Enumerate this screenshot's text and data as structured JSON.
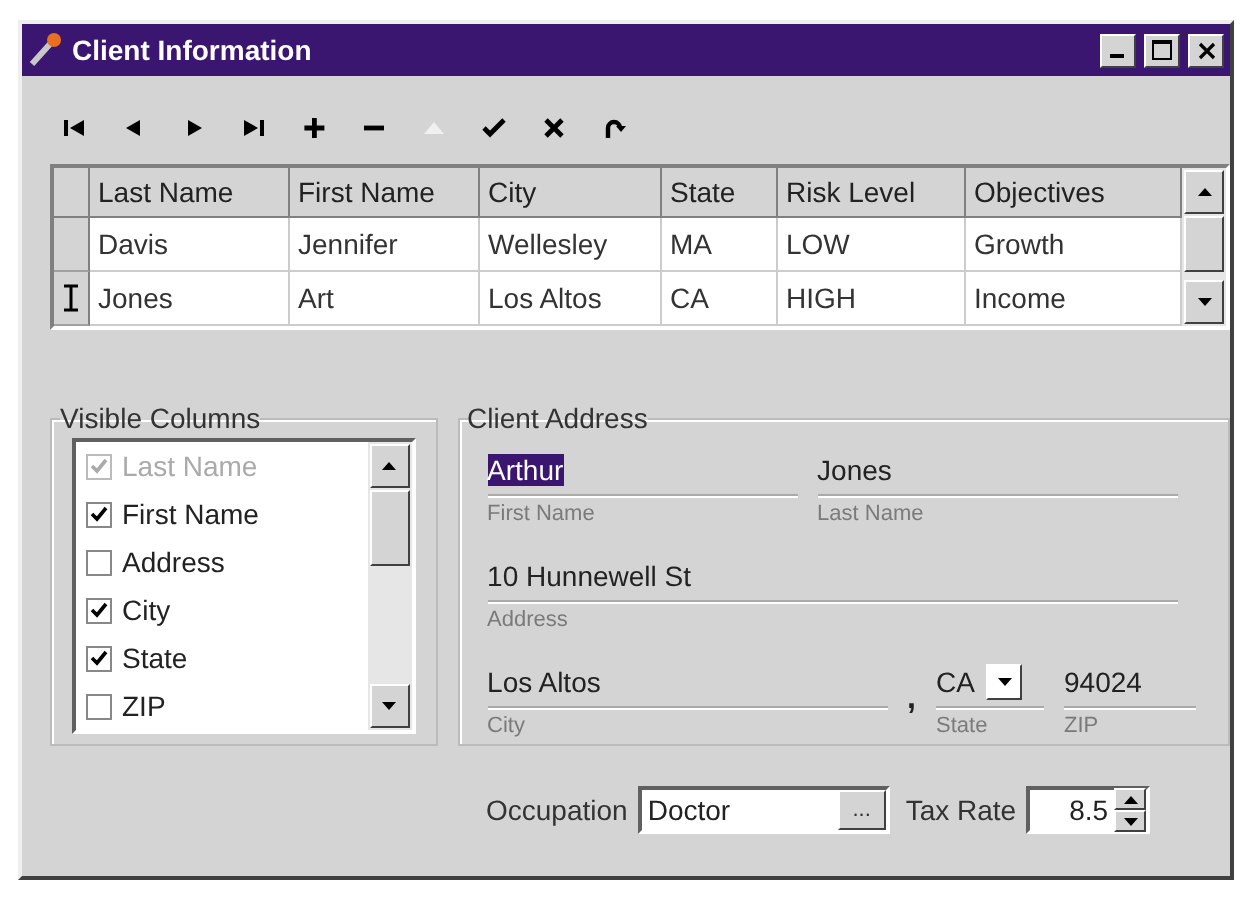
{
  "window": {
    "title": "Client Information"
  },
  "toolbar": [
    {
      "kind": "first",
      "disabled": false
    },
    {
      "kind": "prev",
      "disabled": false
    },
    {
      "kind": "next",
      "disabled": false
    },
    {
      "kind": "last",
      "disabled": false
    },
    {
      "kind": "add",
      "disabled": false
    },
    {
      "kind": "delete",
      "disabled": false
    },
    {
      "kind": "edit",
      "disabled": true
    },
    {
      "kind": "post",
      "disabled": false
    },
    {
      "kind": "cancel",
      "disabled": false
    },
    {
      "kind": "refresh",
      "disabled": false
    }
  ],
  "table": {
    "columns": [
      "Last Name",
      "First Name",
      "City",
      "State",
      "Risk Level",
      "Objectives"
    ],
    "rows": [
      {
        "current": false,
        "cells": [
          "Davis",
          "Jennifer",
          "Wellesley",
          "MA",
          "LOW",
          "Growth"
        ]
      },
      {
        "current": true,
        "cells": [
          "Jones",
          "Art",
          "Los Altos",
          "CA",
          "HIGH",
          "Income"
        ]
      }
    ]
  },
  "visible_columns": {
    "title": "Visible Columns",
    "items": [
      {
        "label": "Last Name",
        "checked": true,
        "disabled": true
      },
      {
        "label": "First Name",
        "checked": true,
        "disabled": false
      },
      {
        "label": "Address",
        "checked": false,
        "disabled": false
      },
      {
        "label": "City",
        "checked": true,
        "disabled": false
      },
      {
        "label": "State",
        "checked": true,
        "disabled": false
      },
      {
        "label": "ZIP",
        "checked": false,
        "disabled": false
      }
    ]
  },
  "client_address": {
    "title": "Client Address",
    "first_name": {
      "value": "Arthur",
      "caption": "First Name",
      "highlighted": true
    },
    "last_name": {
      "value": "Jones",
      "caption": "Last Name",
      "highlighted": false
    },
    "address": {
      "value": "10 Hunnewell St",
      "caption": "Address",
      "highlighted": false
    },
    "city": {
      "value": "Los Altos",
      "caption": "City",
      "highlighted": false
    },
    "separator": ",",
    "state": {
      "value": "CA",
      "caption": "State",
      "highlighted": false
    },
    "zip": {
      "value": "94024",
      "caption": "ZIP",
      "highlighted": false
    }
  },
  "occupation": {
    "label": "Occupation",
    "value": "Doctor",
    "button": "..."
  },
  "tax_rate": {
    "label": "Tax Rate",
    "value": "8.5"
  }
}
